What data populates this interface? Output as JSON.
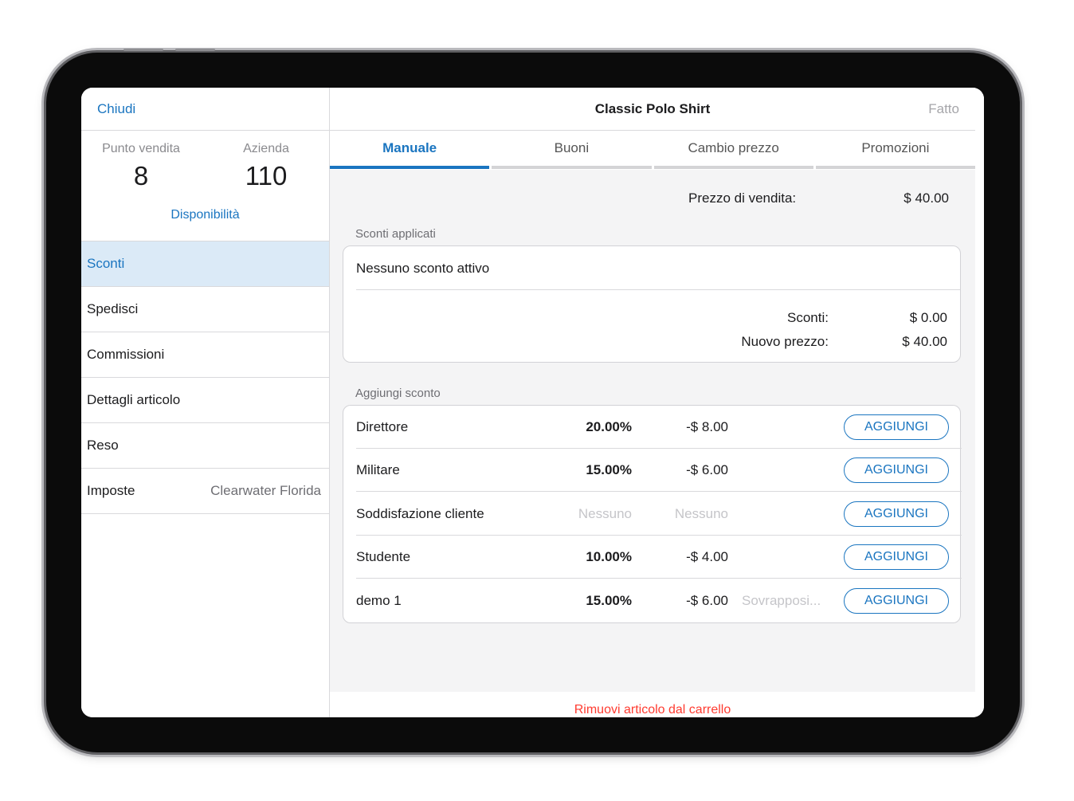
{
  "left": {
    "close_label": "Chiudi",
    "store": {
      "label": "Punto vendita",
      "value": "8"
    },
    "company": {
      "label": "Azienda",
      "value": "110"
    },
    "availability_label": "Disponibilità",
    "menu": [
      {
        "label": "Sconti",
        "active": true
      },
      {
        "label": "Spedisci"
      },
      {
        "label": "Commissioni"
      },
      {
        "label": "Dettagli articolo"
      },
      {
        "label": "Reso"
      },
      {
        "label": "Imposte",
        "value": "Clearwater Florida"
      }
    ]
  },
  "header": {
    "title": "Classic Polo Shirt",
    "done_label": "Fatto"
  },
  "tabs": [
    "Manuale",
    "Buoni",
    "Cambio prezzo",
    "Promozioni"
  ],
  "price": {
    "label": "Prezzo di vendita:",
    "value": "$ 40.00"
  },
  "applied": {
    "section_label": "Sconti applicati",
    "empty_text": "Nessuno sconto attivo",
    "discounts_label": "Sconti:",
    "discounts_value": "$ 0.00",
    "new_price_label": "Nuovo prezzo:",
    "new_price_value": "$ 40.00"
  },
  "add_discount": {
    "section_label": "Aggiungi sconto",
    "button_label": "AGGIUNGI",
    "rows": [
      {
        "name": "Direttore",
        "percent": "20.00%",
        "amount": "-$ 8.00",
        "note": ""
      },
      {
        "name": "Militare",
        "percent": "15.00%",
        "amount": "-$ 6.00",
        "note": ""
      },
      {
        "name": "Soddisfazione cliente",
        "percent": "Nessuno",
        "amount": "Nessuno",
        "note": ""
      },
      {
        "name": "Studente",
        "percent": "10.00%",
        "amount": "-$ 4.00",
        "note": ""
      },
      {
        "name": "demo 1",
        "percent": "15.00%",
        "amount": "-$ 6.00",
        "note": "Sovrapposi..."
      }
    ]
  },
  "remove_label": "Rimuovi articolo dal carrello",
  "colors": {
    "accent": "#1a75c0",
    "destructive": "#ff3b30",
    "selected_bg": "#dbeaf7"
  }
}
